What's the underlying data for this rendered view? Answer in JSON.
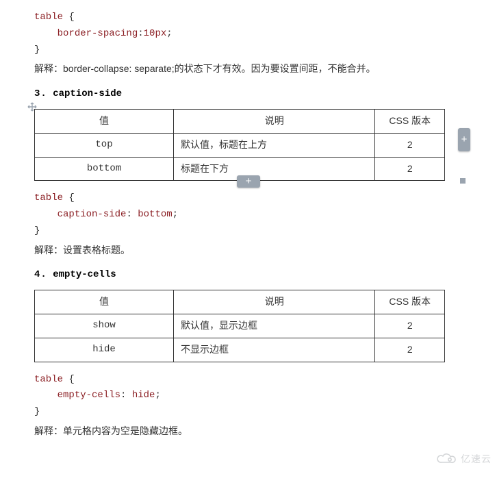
{
  "section1": {
    "code": {
      "line1": {
        "selector": "table",
        "brace_open": "{"
      },
      "line2": {
        "indent": "    ",
        "prop": "border-spacing",
        "colon": ":",
        "value": "10px",
        "semi": ";"
      },
      "line3": {
        "brace_close": "}"
      }
    },
    "explain_label": "解释：",
    "explain_text": "border-collapse: separate;的状态下才有效。因为要设置间距，不能合并。"
  },
  "section3": {
    "heading_num": "3.",
    "heading_text": "caption-side",
    "table_headers": {
      "value": "值",
      "desc": "说明",
      "ver": "CSS 版本"
    },
    "rows": [
      {
        "value": "top",
        "desc": "默认值，标题在上方",
        "ver": "2"
      },
      {
        "value": "bottom",
        "desc": "标题在下方",
        "ver": "2"
      }
    ],
    "code": {
      "line1": {
        "selector": "table",
        "brace_open": "{"
      },
      "line2": {
        "indent": "    ",
        "prop": "caption-side",
        "colon": ": ",
        "value": "bottom",
        "semi": ";"
      },
      "line3": {
        "brace_close": "}"
      }
    },
    "explain_label": "解释：",
    "explain_text": "设置表格标题。"
  },
  "section4": {
    "heading_num": "4.",
    "heading_text": "empty-cells",
    "table_headers": {
      "value": "值",
      "desc": "说明",
      "ver": "CSS 版本"
    },
    "rows": [
      {
        "value": "show",
        "desc": "默认值，显示边框",
        "ver": "2"
      },
      {
        "value": "hide",
        "desc": "不显示边框",
        "ver": "2"
      }
    ],
    "code": {
      "line1": {
        "selector": "table",
        "brace_open": "{"
      },
      "line2": {
        "indent": "    ",
        "prop": "empty-cells",
        "colon": ": ",
        "value": "hide",
        "semi": ";"
      },
      "line3": {
        "brace_close": "}"
      }
    },
    "explain_label": "解释：",
    "explain_text": "单元格内容为空是隐藏边框。"
  },
  "watermark_text": "亿速云",
  "chart_data": [
    {
      "type": "table",
      "title": "caption-side",
      "columns": [
        "值",
        "说明",
        "CSS 版本"
      ],
      "rows": [
        [
          "top",
          "默认值，标题在上方",
          "2"
        ],
        [
          "bottom",
          "标题在下方",
          "2"
        ]
      ]
    },
    {
      "type": "table",
      "title": "empty-cells",
      "columns": [
        "值",
        "说明",
        "CSS 版本"
      ],
      "rows": [
        [
          "show",
          "默认值，显示边框",
          "2"
        ],
        [
          "hide",
          "不显示边框",
          "2"
        ]
      ]
    }
  ]
}
